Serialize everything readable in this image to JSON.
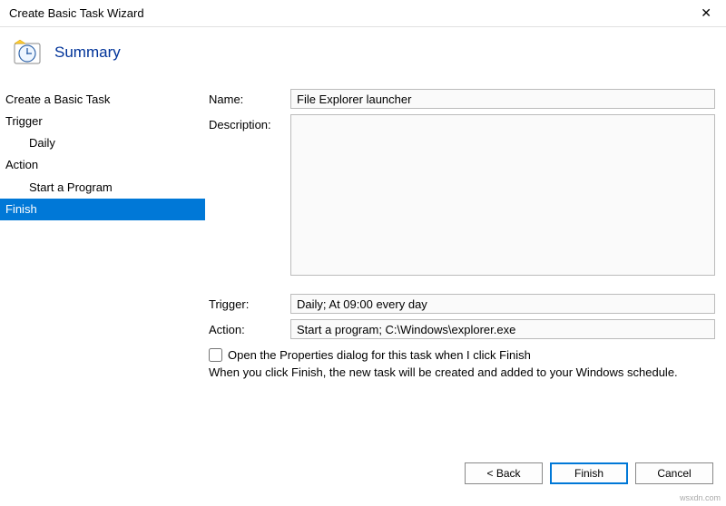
{
  "title_bar": {
    "title": "Create Basic Task Wizard",
    "close": "✕"
  },
  "header": {
    "title": "Summary"
  },
  "sidebar": {
    "items": [
      {
        "label": "Create a Basic Task",
        "indent": false,
        "selected": false
      },
      {
        "label": "Trigger",
        "indent": false,
        "selected": false
      },
      {
        "label": "Daily",
        "indent": true,
        "selected": false
      },
      {
        "label": "Action",
        "indent": false,
        "selected": false
      },
      {
        "label": "Start a Program",
        "indent": true,
        "selected": false
      },
      {
        "label": "Finish",
        "indent": false,
        "selected": true
      }
    ]
  },
  "form": {
    "name_label": "Name:",
    "name_value": "File Explorer launcher",
    "description_label": "Description:",
    "description_value": "",
    "trigger_label": "Trigger:",
    "trigger_value": "Daily; At 09:00 every day",
    "action_label": "Action:",
    "action_value": "Start a program; C:\\Windows\\explorer.exe",
    "checkbox_label": "Open the Properties dialog for this task when I click Finish",
    "info_text": "When you click Finish, the new task will be created and added to your Windows schedule."
  },
  "buttons": {
    "back": "< Back",
    "finish": "Finish",
    "cancel": "Cancel"
  },
  "watermark": "wsxdn.com"
}
